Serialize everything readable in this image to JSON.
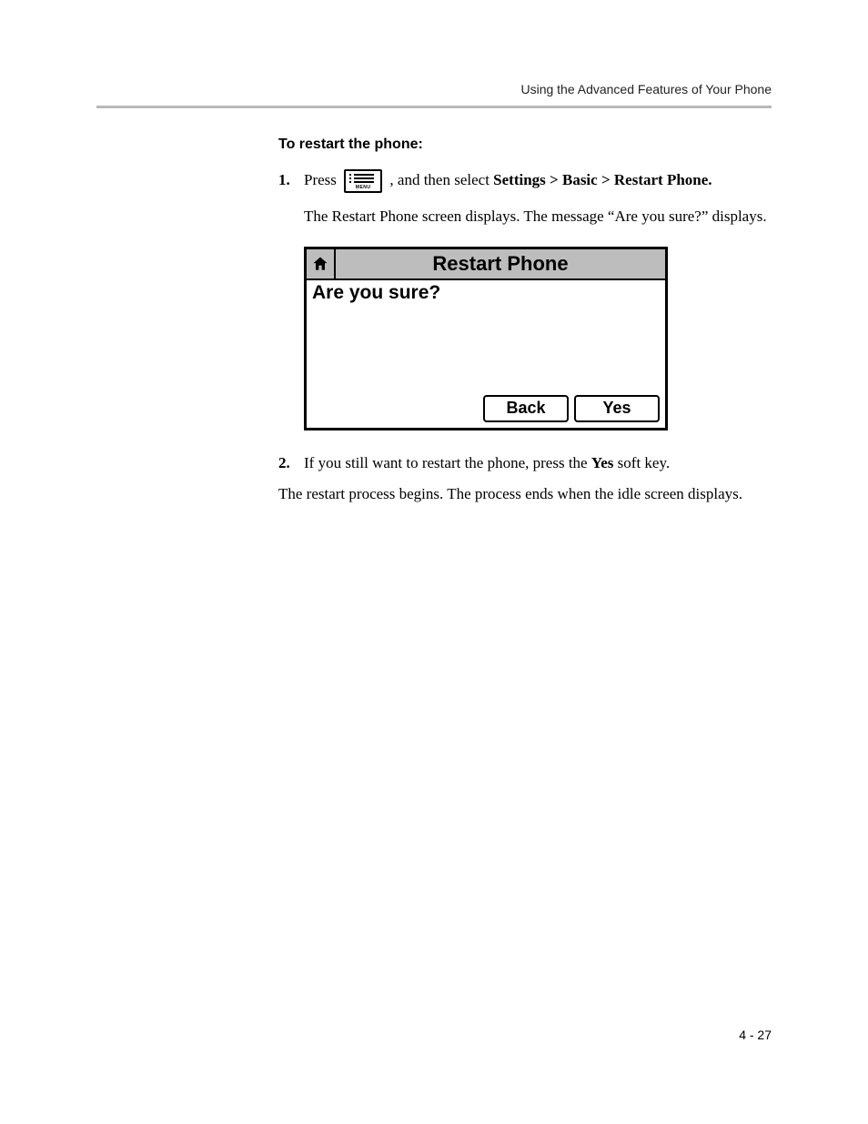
{
  "header": {
    "running_head": "Using the Advanced Features of Your Phone"
  },
  "section": {
    "heading": "To restart the phone:"
  },
  "steps": {
    "s1_num": "1.",
    "s1_pre": "Press ",
    "s1_mid": ", and then select ",
    "s1_path": "Settings > Basic > Restart Phone.",
    "s1_result": "The Restart Phone screen displays. The message “Are you sure?” displays.",
    "s2_num": "2.",
    "s2_pre": "If you still want to restart the phone, press the ",
    "s2_bold": "Yes",
    "s2_post": " soft key."
  },
  "closing": "The restart process begins. The process ends when the idle screen displays.",
  "menu_key_label": "MENU",
  "phone_screen": {
    "title": "Restart Phone",
    "question": "Are you sure?",
    "softkeys": {
      "back": "Back",
      "yes": "Yes"
    }
  },
  "footer": {
    "page": "4 - 27"
  }
}
